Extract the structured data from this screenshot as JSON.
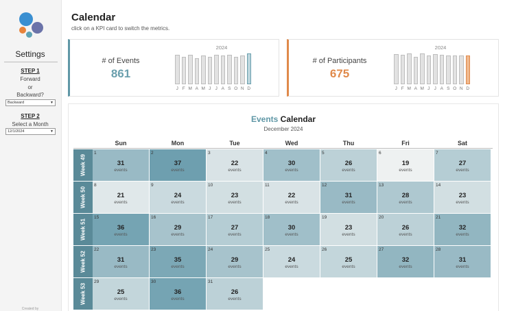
{
  "sidebar": {
    "settings_title": "Settings",
    "step1": {
      "label": "STEP 1",
      "line1": "Forward",
      "line2": "or",
      "line3": "Backward?",
      "select_value": "Backward"
    },
    "step2": {
      "label": "STEP 2",
      "text": "Select a Month",
      "select_value": "12/1/2024"
    },
    "created_by": "Created by"
  },
  "header": {
    "title": "Calendar",
    "subtitle": "click on a KPI card to switch the metrics."
  },
  "kpis": [
    {
      "label": "# of Events",
      "value": "861",
      "year": "2024",
      "color": "#6a9fad",
      "highlight_color": "#bcd5dd",
      "months": [
        "J",
        "F",
        "M",
        "A",
        "M",
        "J",
        "J",
        "A",
        "S",
        "O",
        "N",
        "D"
      ],
      "monthly_relative": [
        0.95,
        0.88,
        0.95,
        0.85,
        0.93,
        0.88,
        0.95,
        0.93,
        0.95,
        0.88,
        0.93,
        1.0
      ]
    },
    {
      "label": "# of Participants",
      "value": "675",
      "year": "2024",
      "color": "#e0894a",
      "highlight_color": "#f0b98e",
      "months": [
        "J",
        "F",
        "M",
        "A",
        "M",
        "J",
        "J",
        "A",
        "S",
        "O",
        "N",
        "D"
      ],
      "monthly_relative": [
        0.98,
        0.95,
        1.0,
        0.88,
        1.0,
        0.93,
        0.98,
        0.95,
        0.93,
        0.93,
        0.93,
        0.93
      ]
    }
  ],
  "calendar": {
    "title_accent": "Events",
    "title_rest": "Calendar",
    "subtitle": "December 2024",
    "weekdays": [
      "Sun",
      "Mon",
      "Tue",
      "Wed",
      "Thu",
      "Fri",
      "Sat"
    ],
    "unit": "events",
    "scale": {
      "min": 19,
      "max": 37,
      "low_color": "#eef1f1",
      "high_color": "#6e9faf"
    },
    "weeks": [
      {
        "label": "Week 49",
        "days": [
          {
            "num": "1",
            "count": 31
          },
          {
            "num": "2",
            "count": 37
          },
          {
            "num": "3",
            "count": 22
          },
          {
            "num": "4",
            "count": 30
          },
          {
            "num": "5",
            "count": 26
          },
          {
            "num": "6",
            "count": 19
          },
          {
            "num": "7",
            "count": 27
          }
        ]
      },
      {
        "label": "Week 50",
        "days": [
          {
            "num": "8",
            "count": 21
          },
          {
            "num": "9",
            "count": 24
          },
          {
            "num": "10",
            "count": 23
          },
          {
            "num": "11",
            "count": 22
          },
          {
            "num": "12",
            "count": 31
          },
          {
            "num": "13",
            "count": 28
          },
          {
            "num": "14",
            "count": 23
          }
        ]
      },
      {
        "label": "Week 51",
        "days": [
          {
            "num": "15",
            "count": 36
          },
          {
            "num": "16",
            "count": 29
          },
          {
            "num": "17",
            "count": 27
          },
          {
            "num": "18",
            "count": 30
          },
          {
            "num": "19",
            "count": 23
          },
          {
            "num": "20",
            "count": 26
          },
          {
            "num": "21",
            "count": 32
          }
        ]
      },
      {
        "label": "Week 52",
        "days": [
          {
            "num": "22",
            "count": 31
          },
          {
            "num": "23",
            "count": 35
          },
          {
            "num": "24",
            "count": 29
          },
          {
            "num": "25",
            "count": 24
          },
          {
            "num": "26",
            "count": 25
          },
          {
            "num": "27",
            "count": 32
          },
          {
            "num": "28",
            "count": 31
          }
        ]
      },
      {
        "label": "Week 53",
        "days": [
          {
            "num": "29",
            "count": 25
          },
          {
            "num": "30",
            "count": 36
          },
          {
            "num": "31",
            "count": 26
          }
        ]
      }
    ]
  }
}
